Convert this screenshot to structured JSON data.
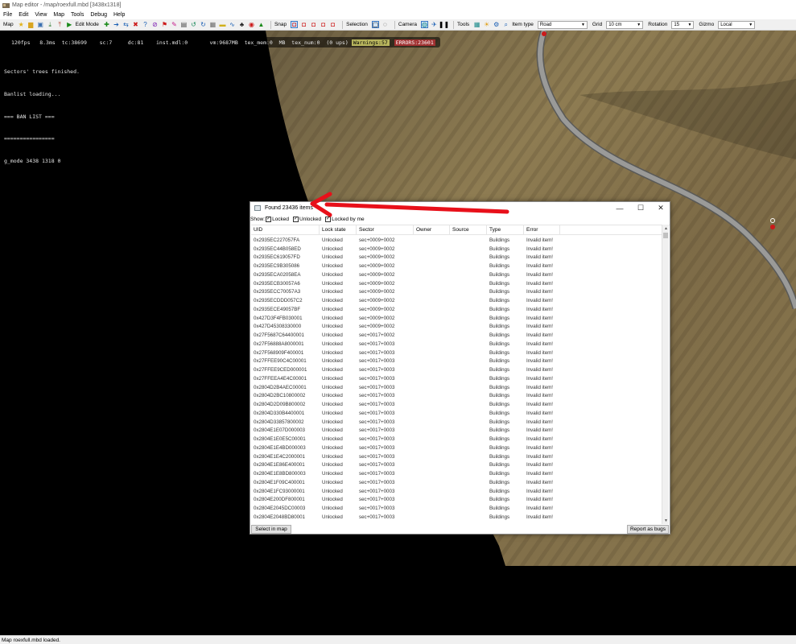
{
  "window": {
    "title": "Map editor - /map/roexfull.mbd [3438x1318]"
  },
  "menu": [
    "File",
    "Edit",
    "View",
    "Map",
    "Tools",
    "Debug",
    "Help"
  ],
  "toolbar": {
    "map_label": "Map",
    "edit_mode_label": "Edit Mode",
    "snap_label": "Snap",
    "selection_label": "Selection",
    "camera_label": "Camera",
    "tools_label": "Tools",
    "item_type_label": "Item type",
    "item_type_value": "Road",
    "grid_label": "Grid",
    "grid_value": "10 cm",
    "rotation_label": "Rotation",
    "rotation_value": "15",
    "gizmo_label": "Gizmo",
    "gizmo_value": "Local"
  },
  "hud": {
    "stats": "120fps   8.3ms  tc:38699    sc:7     dc:81    inst.mdl:0       vm:9687MB  tex_mem:0  MB  tex_num:0  (0 ups)",
    "warnings": "Warnings:57",
    "errors": "ERRORS:23601",
    "console": [
      "Sectors' trees finished.",
      "Banlist loading...",
      "=== BAN LIST ===",
      "================",
      "g_mode 3438 1318 0"
    ]
  },
  "dialog": {
    "title": "Found 23436 items",
    "show_label": "Show:",
    "filters": [
      {
        "label": "Locked",
        "checked": true
      },
      {
        "label": "Unlocked",
        "checked": true
      },
      {
        "label": "Locked by me",
        "checked": true
      }
    ],
    "columns": [
      "UID",
      "Lock state",
      "Sector",
      "Owner",
      "Source",
      "Type",
      "Error"
    ],
    "rows": [
      [
        "0x2935EC227057FA",
        "Unlocked",
        "sec+0009+0002",
        "",
        "",
        "Buildings",
        "Invalid item!"
      ],
      [
        "0x2935EC44B058ED",
        "Unlocked",
        "sec+0009+0002",
        "",
        "",
        "Buildings",
        "Invalid item!"
      ],
      [
        "0x2935EC619057FD",
        "Unlocked",
        "sec+0009+0002",
        "",
        "",
        "Buildings",
        "Invalid item!"
      ],
      [
        "0x2935EC9B305086",
        "Unlocked",
        "sec+0009+0002",
        "",
        "",
        "Buildings",
        "Invalid item!"
      ],
      [
        "0x2935ECA02058EA",
        "Unlocked",
        "sec+0009+0002",
        "",
        "",
        "Buildings",
        "Invalid item!"
      ],
      [
        "0x2935ECB30057A6",
        "Unlocked",
        "sec+0009+0002",
        "",
        "",
        "Buildings",
        "Invalid item!"
      ],
      [
        "0x2935ECC70057A3",
        "Unlocked",
        "sec+0009+0002",
        "",
        "",
        "Buildings",
        "Invalid item!"
      ],
      [
        "0x2935ECDDD057C2",
        "Unlocked",
        "sec+0009+0002",
        "",
        "",
        "Buildings",
        "Invalid item!"
      ],
      [
        "0x2935ECE49057BF",
        "Unlocked",
        "sec+0009+0002",
        "",
        "",
        "Buildings",
        "Invalid item!"
      ],
      [
        "0x427D3F4FB030001",
        "Unlocked",
        "sec+0009+0002",
        "",
        "",
        "Buildings",
        "Invalid item!"
      ],
      [
        "0x427D45308330000",
        "Unlocked",
        "sec+0009+0002",
        "",
        "",
        "Buildings",
        "Invalid item!"
      ],
      [
        "0x27F5687C64400001",
        "Unlocked",
        "sec+0017+0002",
        "",
        "",
        "Buildings",
        "Invalid item!"
      ],
      [
        "0x27F56888A8000001",
        "Unlocked",
        "sec+0017+0003",
        "",
        "",
        "Buildings",
        "Invalid item!"
      ],
      [
        "0x27F568909F400001",
        "Unlocked",
        "sec+0017+0003",
        "",
        "",
        "Buildings",
        "Invalid item!"
      ],
      [
        "0x27FFEE90C4C00001",
        "Unlocked",
        "sec+0017+0003",
        "",
        "",
        "Buildings",
        "Invalid item!"
      ],
      [
        "0x27FFEE9CED000001",
        "Unlocked",
        "sec+0017+0003",
        "",
        "",
        "Buildings",
        "Invalid item!"
      ],
      [
        "0x27FFEEA4E4C00001",
        "Unlocked",
        "sec+0017+0003",
        "",
        "",
        "Buildings",
        "Invalid item!"
      ],
      [
        "0x2804D2B4AEC00001",
        "Unlocked",
        "sec+0017+0003",
        "",
        "",
        "Buildings",
        "Invalid item!"
      ],
      [
        "0x2804D2BC10800002",
        "Unlocked",
        "sec+0017+0003",
        "",
        "",
        "Buildings",
        "Invalid item!"
      ],
      [
        "0x2804D2D09B800002",
        "Unlocked",
        "sec+0017+0003",
        "",
        "",
        "Buildings",
        "Invalid item!"
      ],
      [
        "0x2804D330B4400001",
        "Unlocked",
        "sec+0017+0003",
        "",
        "",
        "Buildings",
        "Invalid item!"
      ],
      [
        "0x2804D33857800002",
        "Unlocked",
        "sec+0017+0003",
        "",
        "",
        "Buildings",
        "Invalid item!"
      ],
      [
        "0x2804E1E07D000003",
        "Unlocked",
        "sec+0017+0003",
        "",
        "",
        "Buildings",
        "Invalid item!"
      ],
      [
        "0x2804E1E0E5C00001",
        "Unlocked",
        "sec+0017+0003",
        "",
        "",
        "Buildings",
        "Invalid item!"
      ],
      [
        "0x2804E1E4BD000003",
        "Unlocked",
        "sec+0017+0003",
        "",
        "",
        "Buildings",
        "Invalid item!"
      ],
      [
        "0x2804E1E4C2000001",
        "Unlocked",
        "sec+0017+0003",
        "",
        "",
        "Buildings",
        "Invalid item!"
      ],
      [
        "0x2804E1E86E400001",
        "Unlocked",
        "sec+0017+0003",
        "",
        "",
        "Buildings",
        "Invalid item!"
      ],
      [
        "0x2804E1E8BD800003",
        "Unlocked",
        "sec+0017+0003",
        "",
        "",
        "Buildings",
        "Invalid item!"
      ],
      [
        "0x2804E1F09C400001",
        "Unlocked",
        "sec+0017+0003",
        "",
        "",
        "Buildings",
        "Invalid item!"
      ],
      [
        "0x2804E1FC93000001",
        "Unlocked",
        "sec+0017+0003",
        "",
        "",
        "Buildings",
        "Invalid item!"
      ],
      [
        "0x2804E200DF800001",
        "Unlocked",
        "sec+0017+0003",
        "",
        "",
        "Buildings",
        "Invalid item!"
      ],
      [
        "0x2804E2045DC00003",
        "Unlocked",
        "sec+0017+0003",
        "",
        "",
        "Buildings",
        "Invalid item!"
      ],
      [
        "0x2804E2048BD80001",
        "Unlocked",
        "sec+0017+0003",
        "",
        "",
        "Buildings",
        "Invalid item!"
      ]
    ],
    "select_button": "Select in map",
    "report_button": "Report as bugs"
  },
  "status": {
    "text": "Map roexfull.mbd loaded."
  },
  "colors": {
    "annotation_arrow": "#e8101a",
    "warning_bg": "#b9b65e",
    "error_bg": "#a03030",
    "terrain": "#8a7850",
    "road": "#9a9a9a"
  }
}
